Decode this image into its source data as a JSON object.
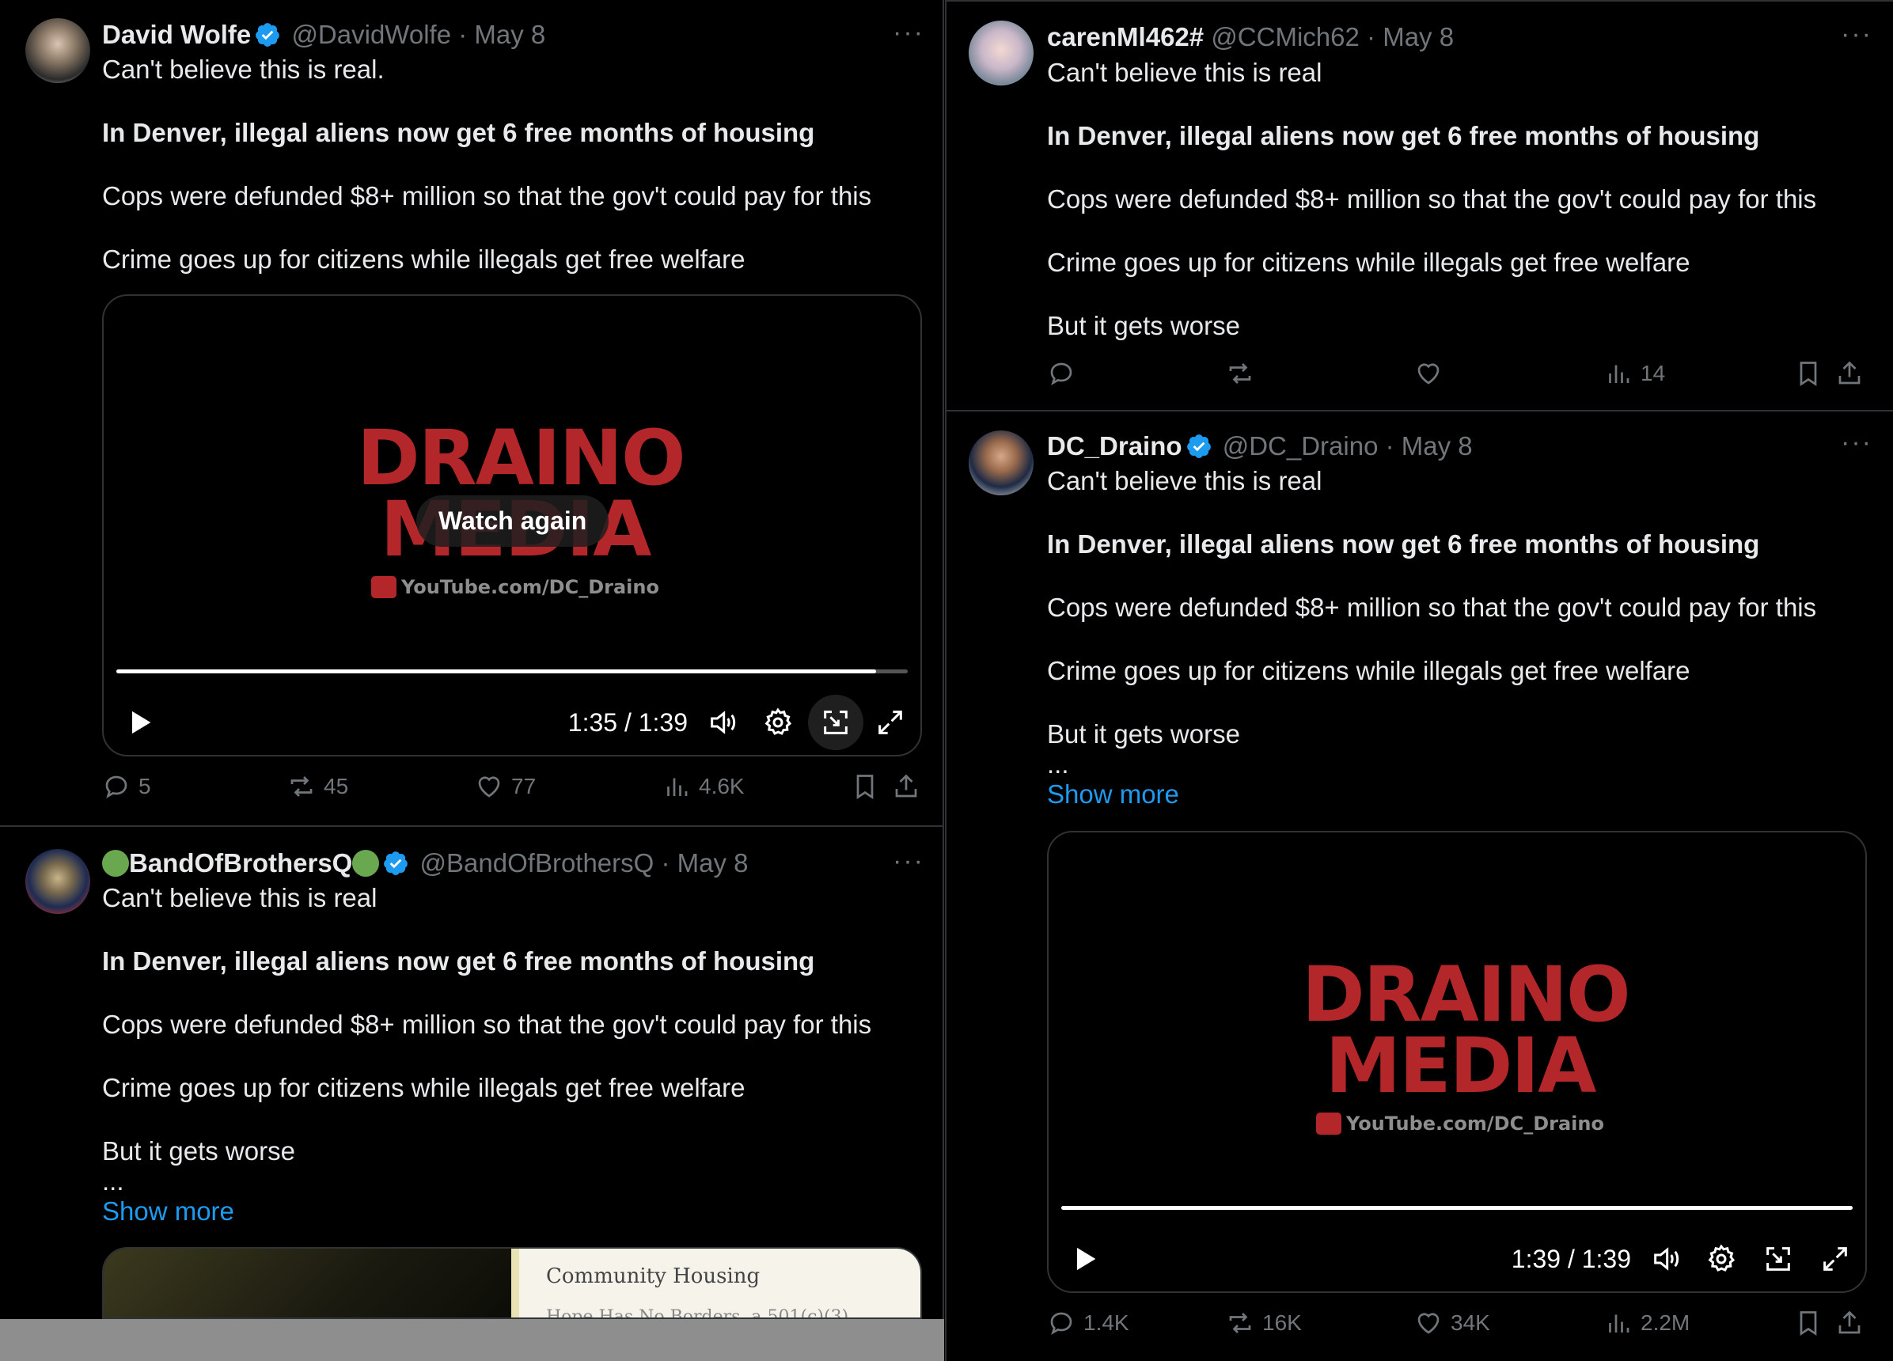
{
  "colors": {
    "background": "#000000",
    "text": "#e7e9ea",
    "muted": "#71767b",
    "link": "#1d9bf0",
    "verified": "#1d9bf0",
    "divider": "#2f3336",
    "logo_red": "#b3262a"
  },
  "tweets": {
    "t1": {
      "name": "David Wolfe",
      "handle": "@DavidWolfe",
      "date": "May 8",
      "line1": "Can't believe this is real.",
      "line2": "In Denver, illegal aliens now get 6 free months of housing",
      "line3": "Cops were defunded $8+ million so that the gov't could pay for this",
      "line4": "Crime goes up for citizens while illegals get free welfare",
      "video": {
        "logo1": "DRAINO",
        "logo2": "MEDIA",
        "yt": "YouTube.com/DC_Draino",
        "overlay": "Watch again",
        "time": "1:35 / 1:39",
        "progress": 0.96
      },
      "stats": {
        "replies": "5",
        "reposts": "45",
        "likes": "77",
        "views": "4.6K"
      }
    },
    "t2": {
      "name": "BandOfBrothersQ",
      "handle": "@BandOfBrothersQ",
      "date": "May 8",
      "line1": "Can't believe this is real",
      "line2": "In Denver, illegal aliens now get 6 free months of housing",
      "line3": "Cops were defunded $8+ million so that the gov't could pay for this",
      "line4": "Crime goes up for citizens while illegals get free welfare",
      "line5": "But it gets worse",
      "ellipsis": "...",
      "show_more": "Show more",
      "card": {
        "title": "Community Housing",
        "subtitle": "Hope Has No Borders, a 501(c)(3)"
      }
    },
    "t3": {
      "name": "carenMl462#",
      "handle": "@CCMich62",
      "date": "May 8",
      "line1": "Can't believe this is real",
      "line2": "In Denver, illegal aliens now get 6 free months of housing",
      "line3": "Cops were defunded $8+ million so that the gov't could pay for this",
      "line4": "Crime goes up for citizens while illegals get free welfare",
      "line5": "But it gets worse",
      "stats": {
        "views": "14"
      }
    },
    "t4": {
      "name": "DC_Draino",
      "handle": "@DC_Draino",
      "date": "May 8",
      "line1": "Can't believe this is real",
      "line2": "In Denver, illegal aliens now get 6 free months of housing",
      "line3": "Cops were defunded $8+ million so that the gov't could pay for this",
      "line4": "Crime goes up for citizens while illegals get free welfare",
      "line5": "But it gets worse",
      "ellipsis": "...",
      "show_more": "Show more",
      "video": {
        "logo1": "DRAINO",
        "logo2": "MEDIA",
        "yt": "YouTube.com/DC_Draino",
        "time": "1:39 / 1:39",
        "progress": 1.0
      },
      "stats": {
        "replies": "1.4K",
        "reposts": "16K",
        "likes": "34K",
        "views": "2.2M"
      }
    }
  },
  "sep": "·",
  "more": "···"
}
